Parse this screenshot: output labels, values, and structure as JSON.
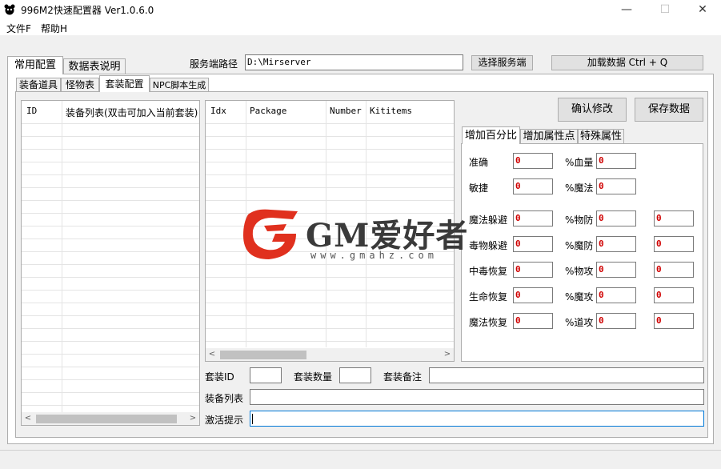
{
  "window": {
    "title": "996M2快速配置器 Ver1.0.6.0",
    "min": "—",
    "max": "☐",
    "close": "✕"
  },
  "menu": {
    "file": "文件F",
    "help": "帮助H"
  },
  "top_tabs": [
    "常用配置",
    "数据表说明"
  ],
  "server_path": {
    "label": "服务端路径",
    "value": "D:\\Mirserver",
    "select_button": "选择服务端",
    "load_button": "加载数据 Ctrl + Q"
  },
  "sub_tabs": [
    "装备道具",
    "怪物表",
    "套装配置",
    "NPC脚本生成"
  ],
  "equip_list": {
    "headers": [
      "ID",
      "装备列表(双击可加入当前套装)"
    ]
  },
  "suit_grid": {
    "headers": [
      "Idx",
      "Package",
      "Number",
      "Kititems"
    ]
  },
  "buttons": {
    "confirm": "确认修改",
    "save": "保存数据"
  },
  "attr_tabs": [
    "增加百分比",
    "增加属性点",
    "特殊属性"
  ],
  "attributes": {
    "accuracy": {
      "label": "准确",
      "value": "0"
    },
    "hp": {
      "label": "%血量",
      "value": "0"
    },
    "agility": {
      "label": "敏捷",
      "value": "0"
    },
    "mp": {
      "label": "%魔法",
      "value": "0"
    },
    "magic_dodge": {
      "label": "魔法躲避",
      "value": "0"
    },
    "phys_def": {
      "label": "%物防",
      "v1": "0",
      "v2": "0"
    },
    "poison_dodge": {
      "label": "毒物躲避",
      "value": "0"
    },
    "magic_def": {
      "label": "%魔防",
      "v1": "0",
      "v2": "0"
    },
    "poison_recover": {
      "label": "中毒恢复",
      "value": "0"
    },
    "phys_atk": {
      "label": "%物攻",
      "v1": "0",
      "v2": "0"
    },
    "hp_recover": {
      "label": "生命恢复",
      "value": "0"
    },
    "magic_atk": {
      "label": "%魔攻",
      "v1": "0",
      "v2": "0"
    },
    "mp_recover": {
      "label": "魔法恢复",
      "value": "0"
    },
    "tao_atk": {
      "label": "%道攻",
      "v1": "0",
      "v2": "0"
    }
  },
  "suit_form": {
    "suit_id_label": "套装ID",
    "suit_count_label": "套装数量",
    "suit_note_label": "套装备注",
    "equip_list_label": "装备列表",
    "activation_label": "激活提示"
  },
  "watermark": {
    "brand": "GM爱好者",
    "url": "www.gmahz.com"
  },
  "colors": {
    "value_red": "#d00000",
    "logo_red": "#e0301e"
  }
}
